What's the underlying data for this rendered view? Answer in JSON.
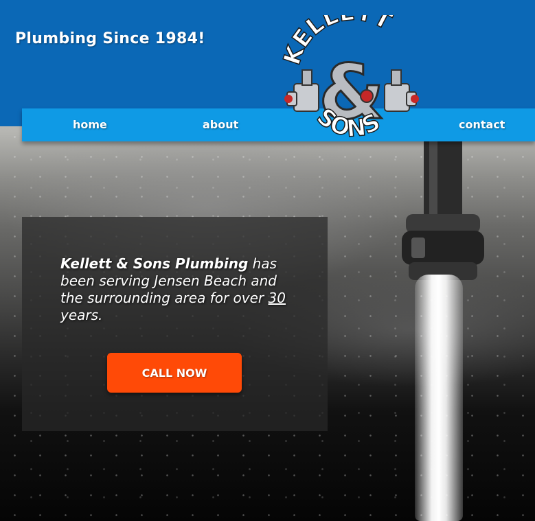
{
  "header": {
    "tagline": "Plumbing Since 1984!",
    "brand_color": "#0b68b6"
  },
  "nav": {
    "color": "#0f9ae5",
    "items": [
      {
        "label": "home"
      },
      {
        "label": "about"
      },
      {
        "label": "contact"
      }
    ]
  },
  "logo": {
    "top_text": "KELLETT",
    "ampersand": "&",
    "bottom_text": "SONS"
  },
  "hero": {
    "intro_company": "Kellett & Sons Plumbing",
    "intro_text_1": "has been serving Jensen Beach and the surrounding area for over",
    "intro_years": "30",
    "intro_text_2": "years.",
    "cta_label": "CALL NOW",
    "cta_color": "#ff4a07"
  }
}
